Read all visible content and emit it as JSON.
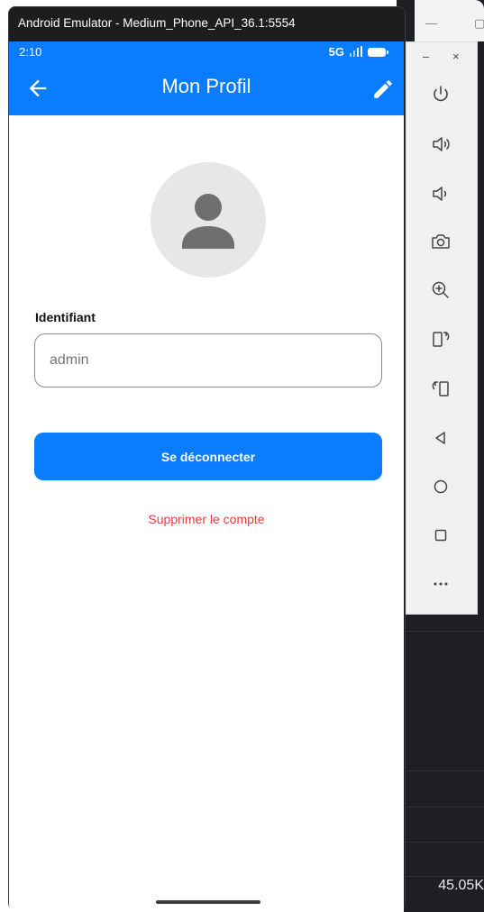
{
  "emulator": {
    "window_title": "Android Emulator - Medium_Phone_API_36.1:5554",
    "minimize_label": "–",
    "close_label": "×"
  },
  "status_bar": {
    "time": "2:10",
    "network": "5G"
  },
  "app_bar": {
    "title": "Mon Profil",
    "back_icon": "arrow-back-icon",
    "edit_icon": "pencil-icon"
  },
  "profile": {
    "avatar_icon": "person-icon",
    "username_label": "Identifiant",
    "username_placeholder": "admin"
  },
  "actions": {
    "logout_label": "Se déconnecter",
    "delete_label": "Supprimer le compte"
  },
  "side_toolbar": [
    "power-icon",
    "volume-up-icon",
    "volume-down-icon",
    "camera-icon",
    "zoom-icon",
    "rotate-left-icon",
    "rotate-right-icon",
    "back-icon",
    "home-icon",
    "overview-icon",
    "more-icon"
  ],
  "background": {
    "status_text": "45.05K"
  },
  "colors": {
    "primary": "#0a7cff",
    "danger": "#f23b3b",
    "avatar_bg": "#e7e7e7"
  }
}
